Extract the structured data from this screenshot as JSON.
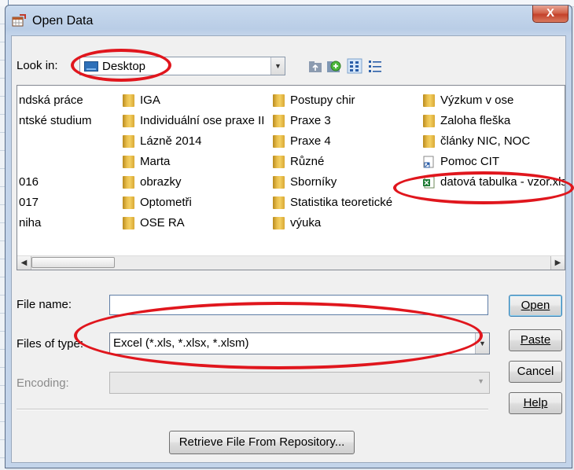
{
  "dialog": {
    "title": "Open Data",
    "close_label": "X"
  },
  "look_in": {
    "label": "Look in:",
    "value": "Desktop"
  },
  "toolbar": {
    "icons": [
      "up-folder-icon",
      "new-folder-icon",
      "list-view-icon",
      "details-view-icon"
    ]
  },
  "files": {
    "col0": [
      "ndská práce",
      "ntské studium",
      "016",
      "017",
      "niha"
    ],
    "col1": [
      "IGA",
      "Individuální ose praxe II",
      "Lázně 2014",
      "Marta",
      "obrazky",
      "Optometři",
      "OSE RA"
    ],
    "col2": [
      "Postupy chir",
      "Praxe 3",
      "Praxe 4",
      "Různé",
      "Sborníky",
      "Statistika teoretické",
      "výuka"
    ],
    "col3": [
      "Výzkum v ose",
      "Zaloha fleška",
      "články NIC, NOC",
      "Pomoc CIT",
      "datová tabulka - vzor.xlsx"
    ]
  },
  "form": {
    "file_name_label": "File name:",
    "file_name_value": "",
    "files_of_type_label": "Files of type:",
    "files_of_type_value": "Excel (*.xls, *.xlsx, *.xlsm)",
    "encoding_label": "Encoding:",
    "encoding_value": ""
  },
  "buttons": {
    "open": "Open",
    "paste": "Paste",
    "cancel": "Cancel",
    "help": "Help",
    "retrieve": "Retrieve File From Repository..."
  },
  "colors": {
    "annotation": "#e0161d",
    "title_bar": "#c9daee",
    "close": "#c4412a"
  }
}
